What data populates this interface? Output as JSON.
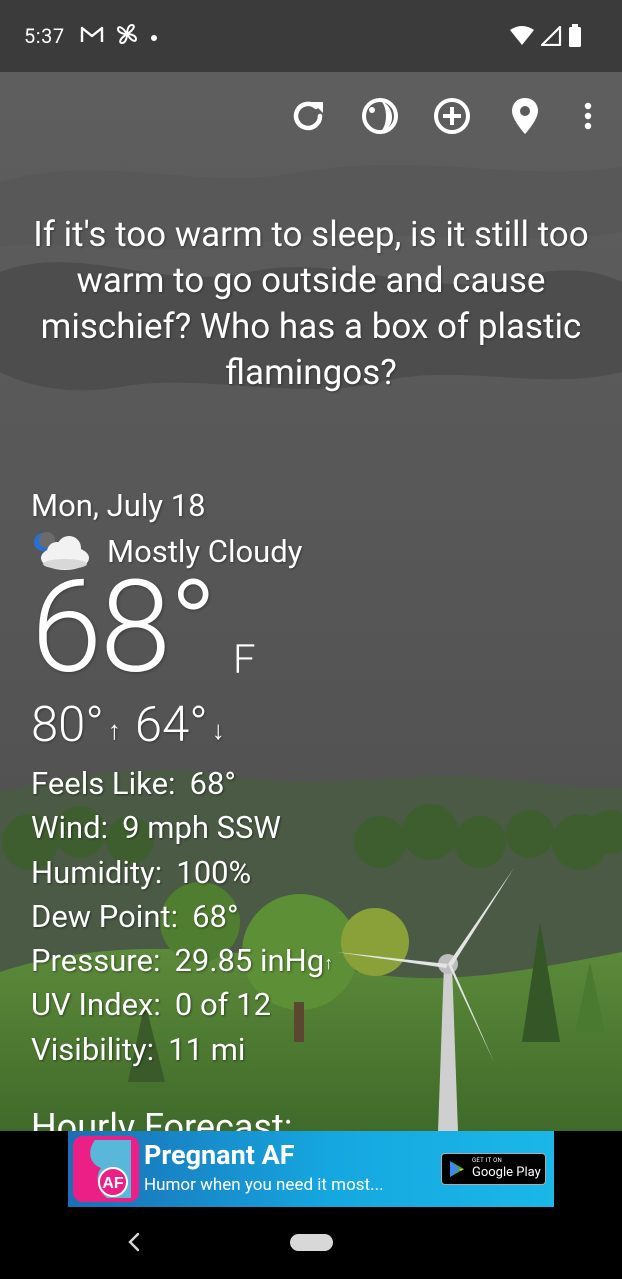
{
  "status_bar": {
    "time": "5:37",
    "left_icons": [
      "gmail-icon",
      "pinwheel-icon",
      "dot-icon"
    ],
    "right_icons": [
      "wifi-icon",
      "signal-icon",
      "battery-icon"
    ]
  },
  "toolbar": {
    "icons": [
      "refresh-icon",
      "theme-icon",
      "add-location-icon",
      "location-pin-icon",
      "more-vert-icon"
    ]
  },
  "quote": "If it's too warm to sleep, is it still too warm to go outside and cause mischief? Who has a box of plastic flamingos?",
  "weather": {
    "date": "Mon, July 18",
    "condition": "Mostly Cloudy",
    "condition_icon": "partly-cloudy-night-icon",
    "temperature": "68°",
    "unit": "F",
    "high": "80°",
    "high_arrow": "↑",
    "low": "64°",
    "low_arrow": "↓",
    "details": {
      "feels_like": {
        "label": "Feels Like:",
        "value": "68°"
      },
      "wind": {
        "label": "Wind:",
        "value": "9 mph SSW"
      },
      "humidity": {
        "label": "Humidity:",
        "value": "100%"
      },
      "dew_point": {
        "label": "Dew Point:",
        "value": "68°"
      },
      "pressure": {
        "label": "Pressure:",
        "value": "29.85 inHg",
        "trend": "↑"
      },
      "uv_index": {
        "label": "UV Index:",
        "value": "0 of 12"
      },
      "visibility": {
        "label": "Visibility:",
        "value": "11 mi"
      }
    }
  },
  "hourly": {
    "title": "Hourly Forecast:"
  },
  "ad": {
    "title": "Pregnant AF",
    "subtitle": "Humor when you need it most...",
    "logo_text": "AF",
    "store_small": "GET IT ON",
    "store_big": "Google Play"
  },
  "colors": {
    "status_bar_bg": "#3b3b3b",
    "sky": "#5a5a5a",
    "grass": "#4f7a33",
    "ad_bg": "#15a8e0",
    "ad_logo": "#ec1f86"
  }
}
